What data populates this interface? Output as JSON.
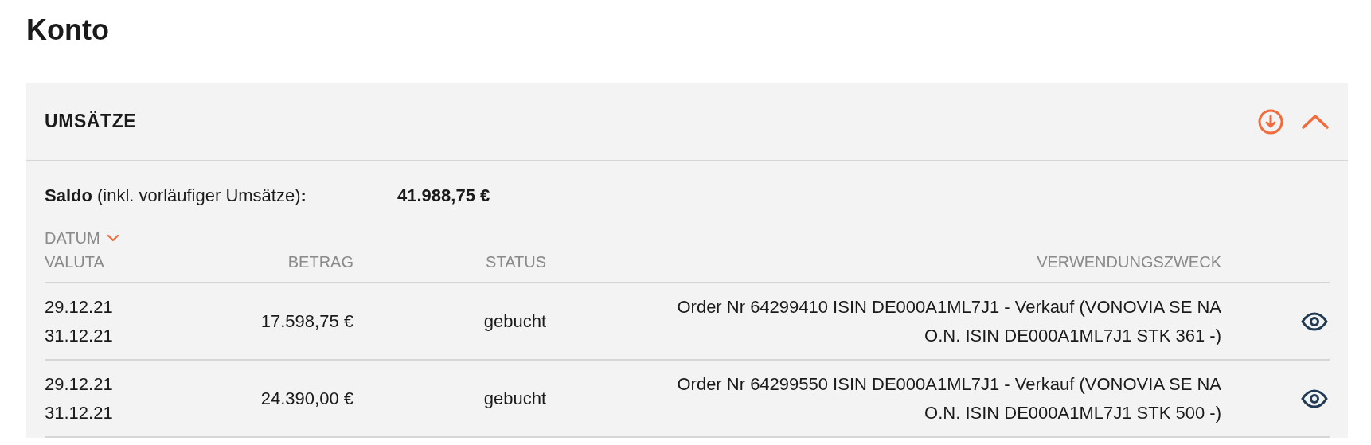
{
  "page_title": "Konto",
  "section": {
    "title": "UMSÄTZE",
    "expanded": true,
    "balance": {
      "label": "**Saldo** (inkl. vorläufiger Umsätze)**:**",
      "amount": "41.988,75 €"
    },
    "columns": [
      {
        "label": "DATUM",
        "sub_label": "VALUTA",
        "sorted": true
      },
      {
        "label": "BETRAG",
        "sorted": false
      },
      {
        "label": "STATUS",
        "sorted": false
      },
      {
        "label": "VERWENDUNGSZWECK",
        "sorted": false
      }
    ],
    "rows": [
      {
        "date": "29.12.21",
        "value_date": "31.12.21",
        "amount": "17.598,75 €",
        "status": "gebucht",
        "purpose_lines": [
          "Order Nr 64299410 ISIN DE000A1ML7J1 - Verkauf (VONOVIA SE NA",
          "O.N. ISIN DE000A1ML7J1 STK 361 -)"
        ]
      },
      {
        "date": "29.12.21",
        "value_date": "31.12.21",
        "amount": "24.390,00 €",
        "status": "gebucht",
        "purpose_lines": [
          "Order Nr 64299550 ISIN DE000A1ML7J1 - Verkauf (VONOVIA SE NA",
          "O.N. ISIN DE000A1ML7J1 STK 500 -)"
        ]
      }
    ]
  }
}
